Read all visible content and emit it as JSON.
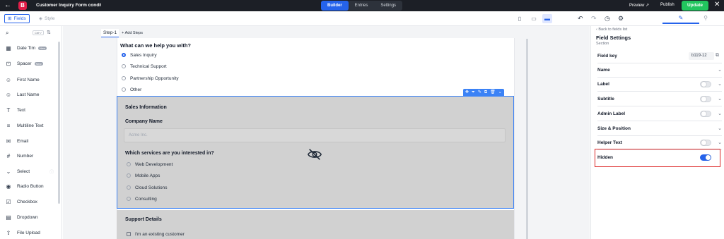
{
  "header": {
    "title": "Customer Inquiry Form conditi",
    "nav_tabs": [
      {
        "label": "Builder",
        "active": true
      },
      {
        "label": "Entries",
        "active": false
      },
      {
        "label": "Settings",
        "active": false
      }
    ],
    "preview_label": "Preview",
    "publish_label": "Publish",
    "update_label": "Update"
  },
  "toolbar": {
    "fields_tab": "Fields",
    "style_tab": "Style"
  },
  "sidebar": {
    "search_shortcut": "Ctrl+/",
    "items": [
      {
        "label": "Date Time",
        "badge": "New",
        "icon": "calendar-icon"
      },
      {
        "label": "Spacer",
        "badge": "New",
        "icon": "spacer-icon"
      },
      {
        "label": "First Name",
        "icon": "user-icon"
      },
      {
        "label": "Last Name",
        "icon": "user-icon"
      },
      {
        "label": "Text",
        "icon": "text-icon"
      },
      {
        "label": "Multiline Text",
        "icon": "paragraph-icon"
      },
      {
        "label": "Email",
        "icon": "mail-icon"
      },
      {
        "label": "Number",
        "icon": "number-icon"
      },
      {
        "label": "Select",
        "icon": "chevron-down-icon"
      },
      {
        "label": "Radio Button",
        "icon": "radio-icon"
      },
      {
        "label": "Checkbox",
        "icon": "checkbox-icon"
      },
      {
        "label": "Dropdown",
        "icon": "dropdown-icon"
      },
      {
        "label": "File Upload",
        "icon": "upload-icon"
      }
    ]
  },
  "canvas": {
    "step_label": "Step-1",
    "add_steps_label": "Add Steps",
    "question": "What can we help you with?",
    "options": [
      {
        "label": "Sales Inquiry",
        "selected": true
      },
      {
        "label": "Technical Support",
        "selected": false
      },
      {
        "label": "Partnership Opportunity",
        "selected": false
      },
      {
        "label": "Other",
        "selected": false
      }
    ],
    "section1": {
      "title": "Sales Information",
      "company_label": "Company Name",
      "company_placeholder": "Acme Inc.",
      "services_question": "Which services are you interested in?",
      "services": [
        "Web Development",
        "Mobile Apps",
        "Cloud Solutions",
        "Consulting"
      ]
    },
    "section2": {
      "title": "Support Details",
      "checkbox_label": "I'm an existing customer"
    }
  },
  "right_panel": {
    "back_link": "Back to fields list",
    "title": "Field Settings",
    "subtitle": "Section",
    "field_key_label": "Field key",
    "field_key_value": "b119-12",
    "rows": [
      {
        "label": "Name",
        "toggle": null
      },
      {
        "label": "Label",
        "toggle": false
      },
      {
        "label": "Subtitle",
        "toggle": false
      },
      {
        "label": "Admin Label",
        "toggle": false
      },
      {
        "label": "Size & Position",
        "toggle": null
      },
      {
        "label": "Helper Text",
        "toggle": false
      },
      {
        "label": "Hidden",
        "toggle": true
      }
    ]
  },
  "colors": {
    "accent": "#2563eb",
    "update_green": "#22c55e",
    "highlight_red": "#dc2626",
    "topbar": "#1c1f26"
  }
}
